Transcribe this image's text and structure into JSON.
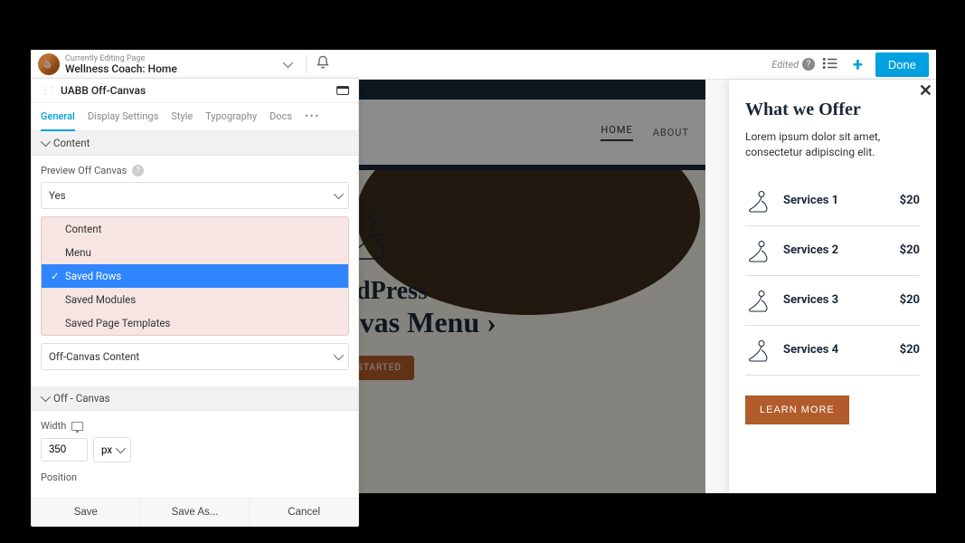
{
  "top": {
    "editing_label": "Currently Editing Page",
    "page_title": "Wellness Coach: Home",
    "edited_label": "Edited",
    "done_label": "Done"
  },
  "panel": {
    "title": "UABB Off-Canvas",
    "tabs": {
      "general": "General",
      "display": "Display Settings",
      "style": "Style",
      "typography": "Typography",
      "docs": "Docs",
      "more": "•••"
    },
    "sections": {
      "content": "Content",
      "off_canvas": "Off - Canvas"
    },
    "fields": {
      "preview_label": "Preview Off Canvas",
      "preview_value": "Yes",
      "dropdown": {
        "content": "Content",
        "menu": "Menu",
        "saved_rows": "Saved Rows",
        "saved_modules": "Saved Modules",
        "saved_templates": "Saved Page Templates"
      },
      "content_type_label": "Off-Canvas Content",
      "width_label": "Width",
      "width_value": "350",
      "width_unit": "px",
      "position_label": "Position"
    },
    "footer": {
      "save": "Save",
      "save_as": "Save As...",
      "cancel": "Cancel"
    }
  },
  "canvas": {
    "nav": {
      "home": "HOME",
      "about": "ABOUT"
    },
    "hero": {
      "line1": "WordPress",
      "line2": "‹ Off-Canvas Menu ›",
      "cta": "GET STARTED"
    }
  },
  "offcanvas": {
    "heading": "What we Offer",
    "body": "Lorem ipsum dolor sit amet, consectetur adipiscing elit.",
    "services": [
      {
        "name": "Services 1",
        "price": "$20"
      },
      {
        "name": "Services 2",
        "price": "$20"
      },
      {
        "name": "Services 3",
        "price": "$20"
      },
      {
        "name": "Services 4",
        "price": "$20"
      }
    ],
    "learn": "LEARN MORE"
  }
}
